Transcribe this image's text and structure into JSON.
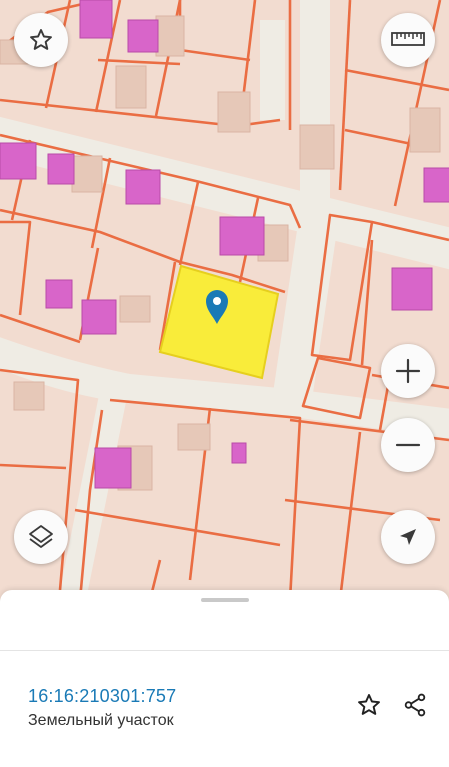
{
  "map": {
    "colors": {
      "background": "#f2dcd0",
      "roads": "#efece4",
      "parcel_border": "#ea6d43",
      "buildings": "#d865c9",
      "outbuildings": "#e6c8b8",
      "selected_parcel": "#f9ec3a",
      "marker": "#1a7ab6"
    }
  },
  "controls": {
    "favorite": "star-outline-icon",
    "ruler": "ruler-icon",
    "zoom_in": "plus-icon",
    "zoom_out": "minus-icon",
    "layers": "layers-icon",
    "my_location": "navigation-arrow-icon"
  },
  "sheet": {
    "cadastral_number": "16:16:210301:757",
    "object_type": "Земельный участок",
    "accent_color": "#1a7ab6",
    "actions": [
      "star-outline-icon",
      "share-icon"
    ]
  }
}
